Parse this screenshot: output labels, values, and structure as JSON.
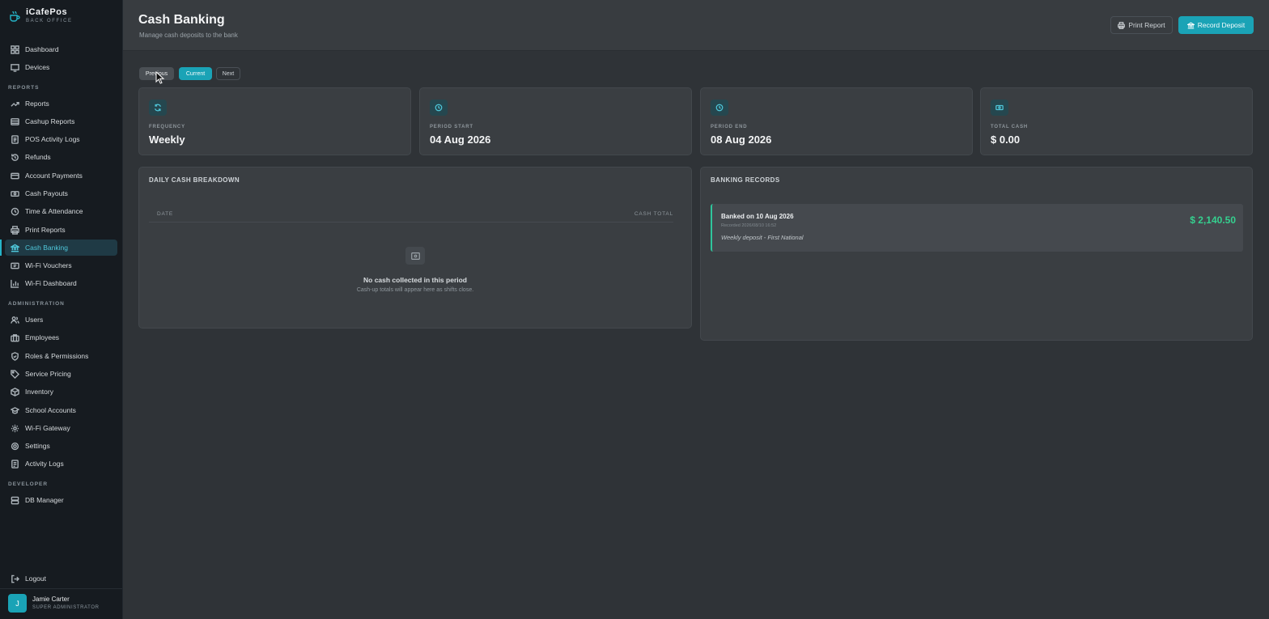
{
  "brand": {
    "name": "iCafePos",
    "subtitle": "BACK OFFICE"
  },
  "sidebar": {
    "top_items": [
      {
        "label": "Dashboard",
        "icon": "grid-icon"
      },
      {
        "label": "Devices",
        "icon": "monitor-icon"
      }
    ],
    "sections": {
      "reports": "REPORTS",
      "administration": "ADMINISTRATION",
      "developer": "DEVELOPER"
    },
    "report_items": [
      {
        "label": "Reports",
        "icon": "trend-icon"
      },
      {
        "label": "Cashup Reports",
        "icon": "stack-icon"
      },
      {
        "label": "POS Activity Logs",
        "icon": "list-icon"
      },
      {
        "label": "Refunds",
        "icon": "history-icon"
      },
      {
        "label": "Account Payments",
        "icon": "card-icon"
      },
      {
        "label": "Cash Payouts",
        "icon": "cash-icon"
      },
      {
        "label": "Time & Attendance",
        "icon": "clock-icon"
      },
      {
        "label": "Print Reports",
        "icon": "printer-icon"
      },
      {
        "label": "Cash Banking",
        "icon": "bank-icon"
      },
      {
        "label": "Wi-Fi Vouchers",
        "icon": "ticket-icon"
      },
      {
        "label": "Wi-Fi Dashboard",
        "icon": "bar-chart-icon"
      }
    ],
    "admin_items": [
      {
        "label": "Users",
        "icon": "users-icon"
      },
      {
        "label": "Employees",
        "icon": "briefcase-icon"
      },
      {
        "label": "Roles & Permissions",
        "icon": "shield-icon"
      },
      {
        "label": "Service Pricing",
        "icon": "tag-icon"
      },
      {
        "label": "Inventory",
        "icon": "box-icon"
      },
      {
        "label": "School Accounts",
        "icon": "graduation-icon"
      },
      {
        "label": "Wi-Fi Gateway",
        "icon": "gear-icon"
      },
      {
        "label": "Settings",
        "icon": "settings-icon"
      },
      {
        "label": "Activity Logs",
        "icon": "log-icon"
      }
    ],
    "developer_items": [
      {
        "label": "DB Manager",
        "icon": "database-icon"
      }
    ],
    "logout": "Logout",
    "user": {
      "initial": "J",
      "name": "Jamie Carter",
      "role": "SUPER ADMINISTRATOR"
    }
  },
  "header": {
    "title": "Cash Banking",
    "subtitle": "Manage cash deposits to the bank",
    "print_label": "Print Report",
    "record_label": "Record Deposit"
  },
  "period_nav": {
    "previous": "Previous",
    "current": "Current",
    "next": "Next"
  },
  "stats": [
    {
      "label": "FREQUENCY",
      "value": "Weekly",
      "icon": "refresh-icon"
    },
    {
      "label": "PERIOD START",
      "value": "04 Aug 2026",
      "icon": "clock-icon"
    },
    {
      "label": "PERIOD END",
      "value": "08 Aug 2026",
      "icon": "clock-icon"
    },
    {
      "label": "TOTAL CASH",
      "value": "$ 0.00",
      "icon": "cash-icon"
    }
  ],
  "daily": {
    "title": "DAILY CASH BREAKDOWN",
    "col_date": "DATE",
    "col_total": "CASH TOTAL",
    "empty_title": "No cash collected in this period",
    "empty_sub": "Cash-up totals will appear here as shifts close."
  },
  "banking": {
    "title": "BANKING RECORDS",
    "records": [
      {
        "title": "Banked on 10 Aug 2026",
        "meta": "Recorded 2026/08/10 16:52",
        "note": "Weekly deposit - First National",
        "amount": "$ 2,140.50"
      }
    ]
  },
  "colors": {
    "accent": "#1aa3b6",
    "positive": "#35d08f"
  }
}
